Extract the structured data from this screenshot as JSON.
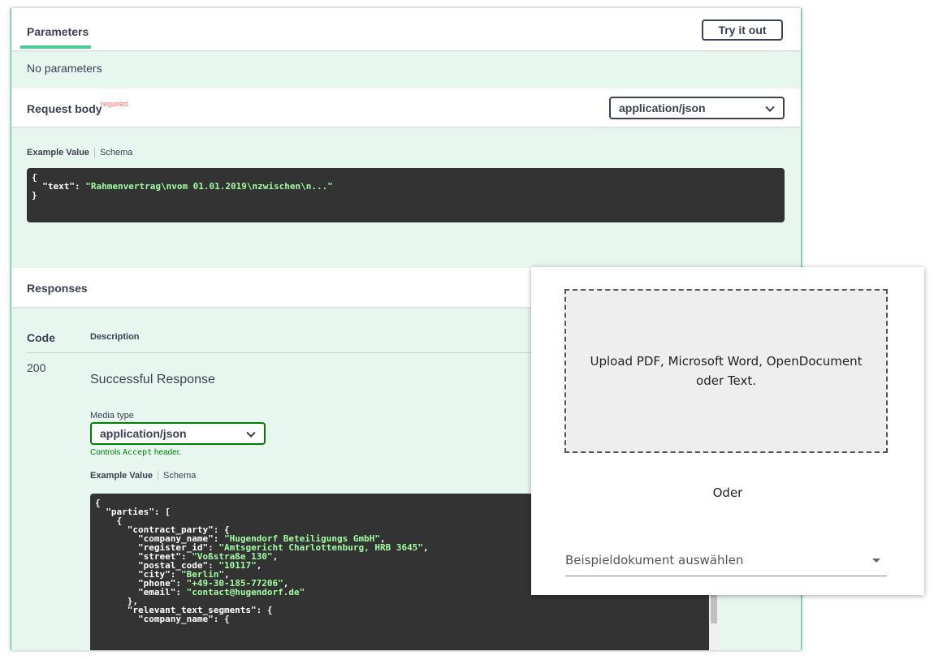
{
  "parameters": {
    "tab_label": "Parameters",
    "try_label": "Try it out",
    "empty_text": "No parameters"
  },
  "request_body": {
    "title": "Request body",
    "required_label": "required",
    "content_type": "application/json",
    "tab_example": "Example Value",
    "tab_schema": "Schema",
    "example_lines": [
      "{",
      "  \"text\": \"Rahmenvertrag\\nvom 01.01.2019\\nzwischen\\n...\"",
      "}"
    ]
  },
  "responses": {
    "title": "Responses",
    "col_code": "Code",
    "col_description": "Description",
    "code": "200",
    "description": "Successful Response",
    "media_type_label": "Media type",
    "media_type": "application/json",
    "controls_prefix": "Controls ",
    "controls_code": "Accept",
    "controls_suffix": " header.",
    "tab_example": "Example Value",
    "tab_schema": "Schema",
    "example_lines": [
      "{",
      "  \"parties\": [",
      "    {",
      "      \"contract_party\": {",
      "        \"company_name\": \"Hugendorf Beteiligungs GmbH\",",
      "        \"register_id\": \"Amtsgericht Charlottenburg, HRB 3645\",",
      "        \"street\": \"Voßstraße 130\",",
      "        \"postal_code\": \"10117\",",
      "        \"city\": \"Berlin\",",
      "        \"phone\": \"+49-30-185-77206\",",
      "        \"email\": \"contact@hugendorf.de\"",
      "      },",
      "      \"relevant_text_segments\": {",
      "        \"company_name\": {"
    ]
  },
  "upload_panel": {
    "dropzone_text": "Upload PDF, Microsoft Word, OpenDocument oder Text.",
    "separator": "Oder",
    "select_placeholder": "Beispieldokument auswählen"
  },
  "colors": {
    "accent": "#49cc90",
    "section_bg": "#e8f6f0",
    "code_bg": "#333333",
    "string": "#a2fca2",
    "required": "#ff6060"
  }
}
